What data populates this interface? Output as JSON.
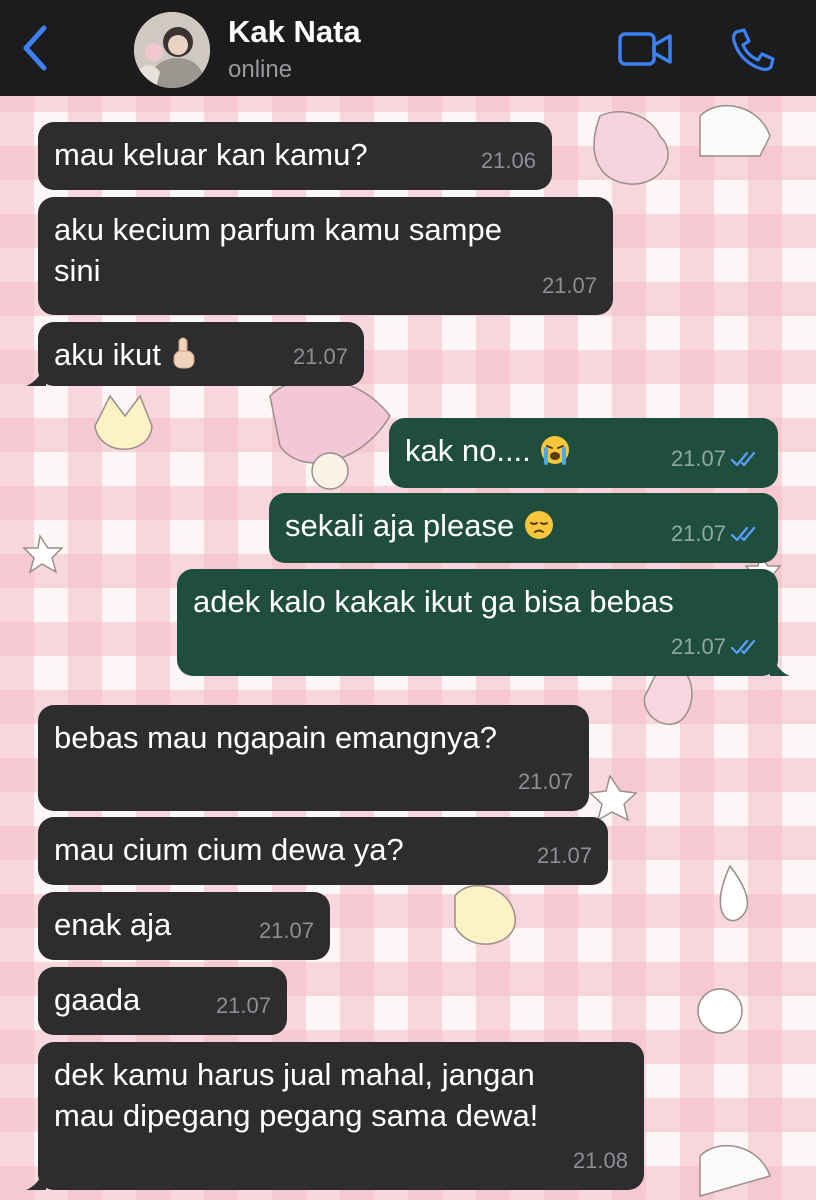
{
  "header": {
    "back_icon": "chevron-left-icon",
    "contact_name": "Kak Nata",
    "contact_status": "online",
    "video_icon": "video-call-icon",
    "phone_icon": "phone-call-icon",
    "accent_color": "#3b82f6"
  },
  "messages": [
    {
      "direction": "in",
      "text": "mau keluar kan kamu?",
      "time": "21.06"
    },
    {
      "direction": "in",
      "text": "aku kecium parfum kamu sampe",
      "text2": "sini",
      "time": "21.07"
    },
    {
      "direction": "in",
      "text": "aku ikut",
      "emoji": "pointing-up-emoji",
      "time": "21.07"
    },
    {
      "direction": "out",
      "text": "kak no....",
      "emoji": "crying-face-emoji",
      "time": "21.07",
      "status": "read"
    },
    {
      "direction": "out",
      "text": "sekali aja please",
      "emoji": "pensive-face-emoji",
      "time": "21.07",
      "status": "read"
    },
    {
      "direction": "out",
      "text": "adek kalo kakak ikut ga bisa bebas",
      "time": "21.07",
      "status": "read"
    },
    {
      "direction": "in",
      "text": "bebas mau ngapain emangnya?",
      "time": "21.07"
    },
    {
      "direction": "in",
      "text": "mau cium cium dewa ya?",
      "time": "21.07"
    },
    {
      "direction": "in",
      "text": "enak aja",
      "time": "21.07"
    },
    {
      "direction": "in",
      "text": "gaada",
      "time": "21.07"
    },
    {
      "direction": "in",
      "text": "dek kamu harus jual mahal, jangan",
      "text2": "mau dipegang pegang sama dewa!",
      "time": "21.08"
    }
  ],
  "colors": {
    "incoming_bubble": "#2d2d2f",
    "outgoing_bubble": "#1f4e3f",
    "read_ticks": "#5aa0ff"
  }
}
